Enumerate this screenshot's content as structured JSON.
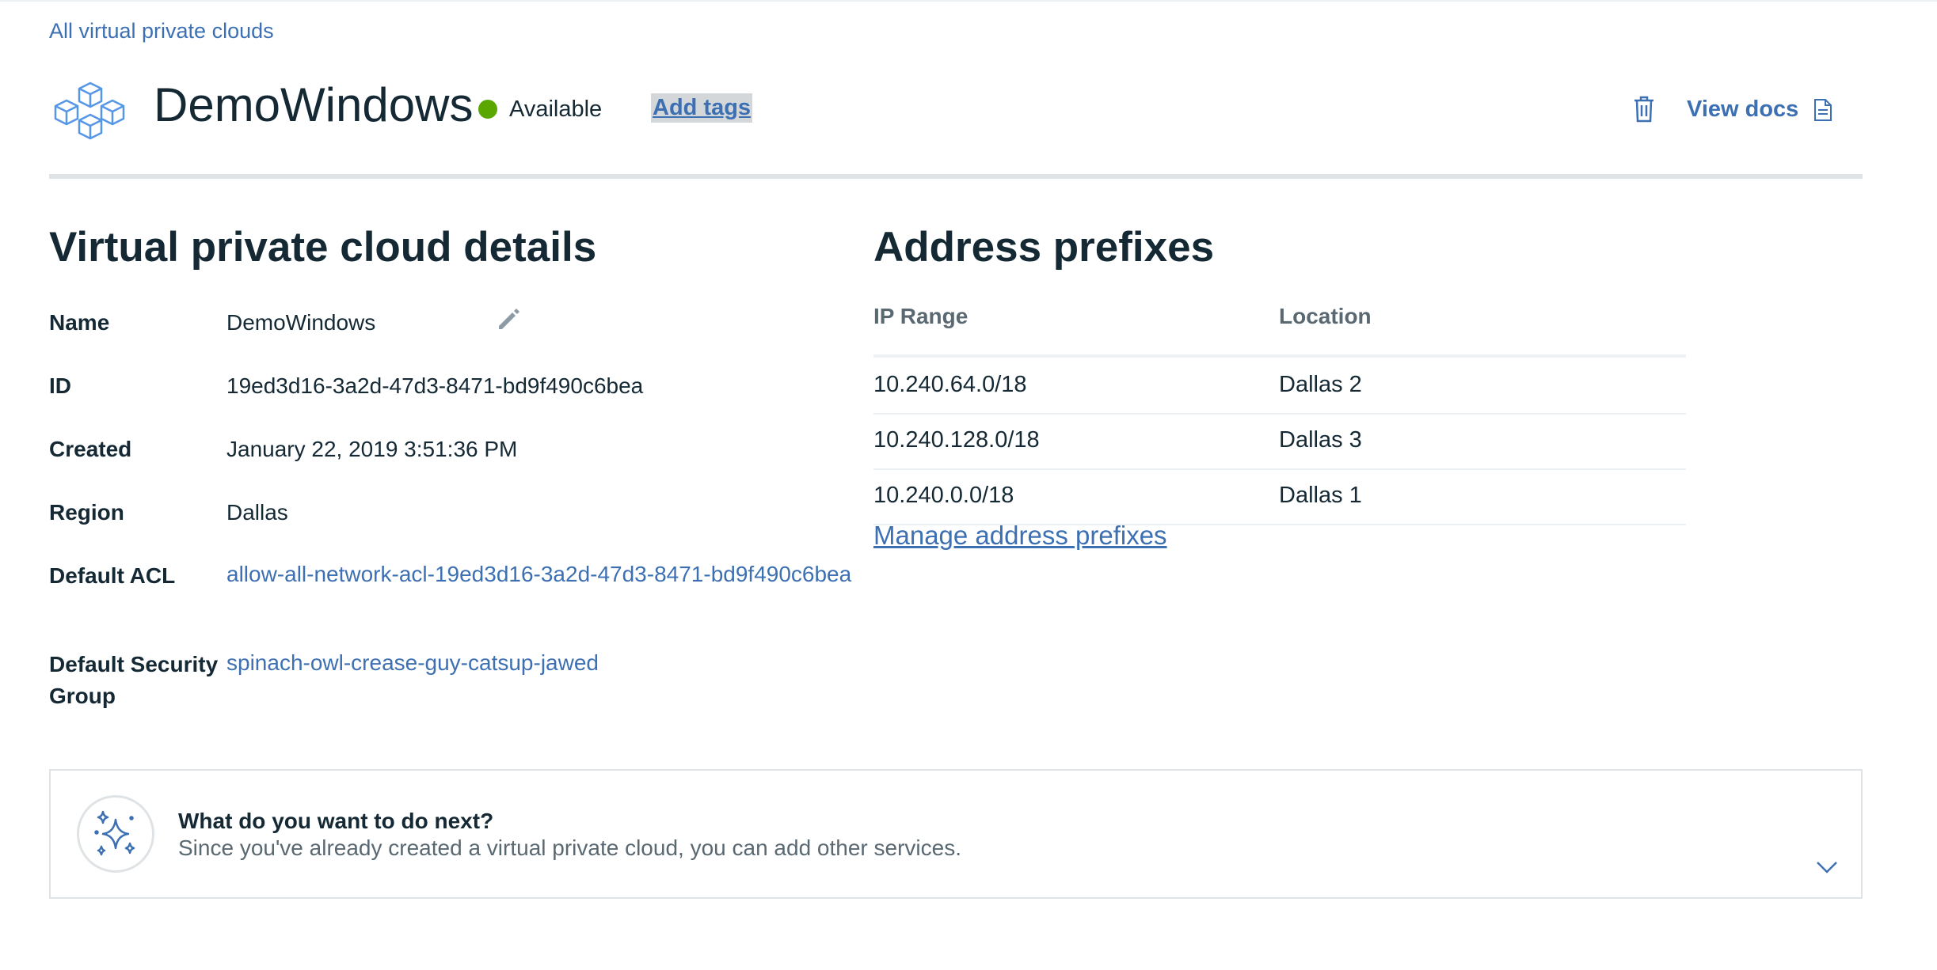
{
  "breadcrumb": {
    "label": "All virtual private clouds"
  },
  "header": {
    "title": "DemoWindows",
    "status": "Available",
    "status_color": "#5aa700",
    "add_tags_label": "Add tags",
    "view_docs_label": "View docs",
    "icons": [
      "vpc-cubes-icon",
      "trash-icon",
      "document-icon"
    ]
  },
  "details": {
    "title": "Virtual private cloud details",
    "rows": [
      {
        "label": "Name",
        "value": "DemoWindows",
        "editable": true
      },
      {
        "label": "ID",
        "value": "19ed3d16-3a2d-47d3-8471-bd9f490c6bea"
      },
      {
        "label": "Created",
        "value": "January 22, 2019 3:51:36 PM"
      },
      {
        "label": "Region",
        "value": "Dallas"
      },
      {
        "label": "Default ACL",
        "value": "allow-all-network-acl-19ed3d16-3a2d-47d3-8471-bd9f490c6bea",
        "link": true
      },
      {
        "label": "Default Security Group",
        "value": "spinach-owl-crease-guy-catsup-jawed",
        "link": true
      }
    ]
  },
  "prefixes": {
    "title": "Address prefixes",
    "columns": [
      "IP Range",
      "Location"
    ],
    "rows": [
      {
        "ip": "10.240.64.0/18",
        "location": "Dallas 2"
      },
      {
        "ip": "10.240.128.0/18",
        "location": "Dallas 3"
      },
      {
        "ip": "10.240.0.0/18",
        "location": "Dallas 1"
      }
    ],
    "manage_label": "Manage address prefixes"
  },
  "next": {
    "title": "What do you want to do next?",
    "description": "Since you've already created a virtual private cloud, you can add other services."
  },
  "colors": {
    "link": "#3d70b2",
    "text": "#152935",
    "muted": "#5a6872",
    "status_available": "#5aa700"
  }
}
